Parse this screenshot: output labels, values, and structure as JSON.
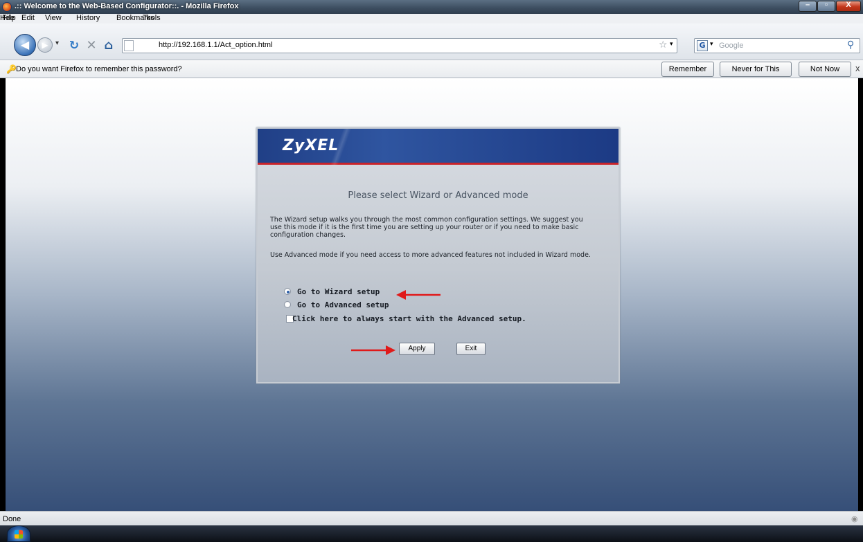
{
  "window": {
    "title": ".:: Welcome to the Web-Based Configurator::. - Mozilla Firefox",
    "controls": {
      "minimize": "–",
      "maximize": "▫",
      "close": "X"
    }
  },
  "menu": [
    "File",
    "Edit",
    "View",
    "History",
    "Bookmarks",
    "Tools",
    "Help"
  ],
  "nav": {
    "url": "http://192.168.1.1/Act_option.html",
    "search_placeholder": "Google",
    "search_engine_letter": "G"
  },
  "password_bar": {
    "message": "Do you want Firefox to remember this password?",
    "remember": "Remember",
    "never": "Never for This Site",
    "not_now": "Not Now",
    "close": "x"
  },
  "panel": {
    "logo": "ZyXEL",
    "title": "Please select Wizard or Advanced mode",
    "para1": "The Wizard setup walks you through the most common configuration settings. We suggest you use this mode if it is the first time you are setting up your router or if you need to make basic configuration changes.",
    "para2": "Use Advanced mode if you need access to more advanced features not included in Wizard mode.",
    "option_wizard": "Go to Wizard setup",
    "option_advanced": "Go to Advanced setup",
    "option_always_advanced": "Click here to always start with the Advanced setup.",
    "apply": "Apply",
    "exit": "Exit",
    "selected": "wizard",
    "always_advanced_checked": false,
    "annotation_color": "#e01a1a"
  },
  "status": {
    "text": "Done"
  }
}
